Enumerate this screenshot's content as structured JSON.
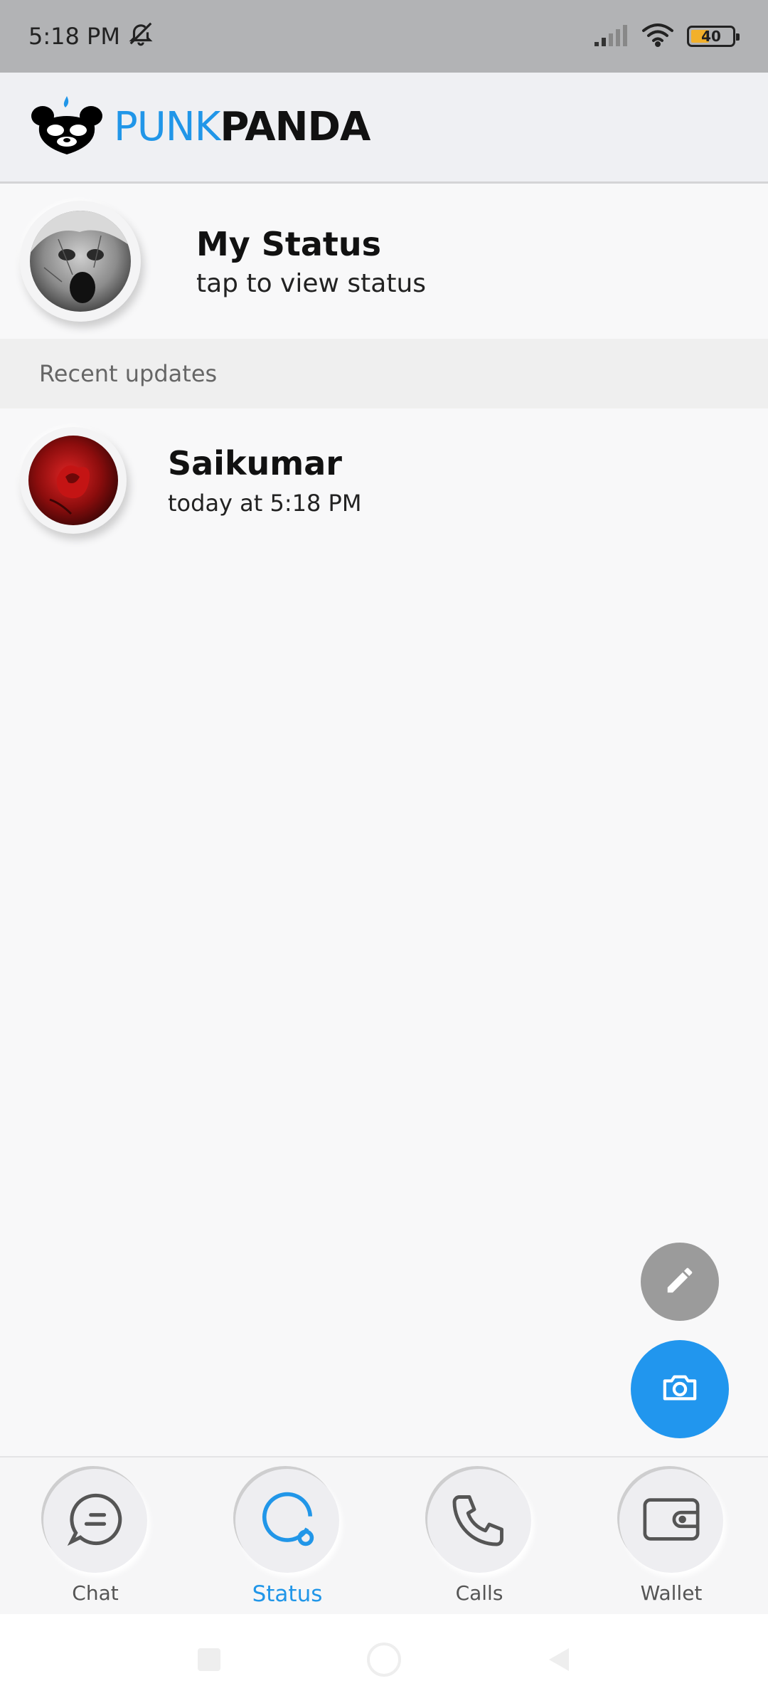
{
  "status_bar": {
    "time": "5:18 PM",
    "battery": "40",
    "icons": [
      "mute-bell-icon",
      "signal-icon",
      "wifi-icon",
      "battery-icon"
    ]
  },
  "header": {
    "brand_part1": "PUNK",
    "brand_part2": "PANDA",
    "logo": "panda-logo"
  },
  "my_status": {
    "title": "My Status",
    "subtitle": "tap to view status"
  },
  "section": {
    "recent_updates": "Recent updates"
  },
  "updates": [
    {
      "name": "Saikumar",
      "time": "today at 5:18 PM"
    }
  ],
  "fabs": {
    "edit": "pencil-icon",
    "camera": "camera-icon"
  },
  "bottom_nav": {
    "items": [
      {
        "label": "Chat",
        "icon": "chat-bubble-icon"
      },
      {
        "label": "Status",
        "icon": "status-ring-icon",
        "active": true
      },
      {
        "label": "Calls",
        "icon": "phone-icon"
      },
      {
        "label": "Wallet",
        "icon": "wallet-icon"
      }
    ]
  },
  "colors": {
    "accent": "#2196e8",
    "status_bar_bg": "#b2b3b5",
    "fab_edit": "#9b9b9b"
  }
}
